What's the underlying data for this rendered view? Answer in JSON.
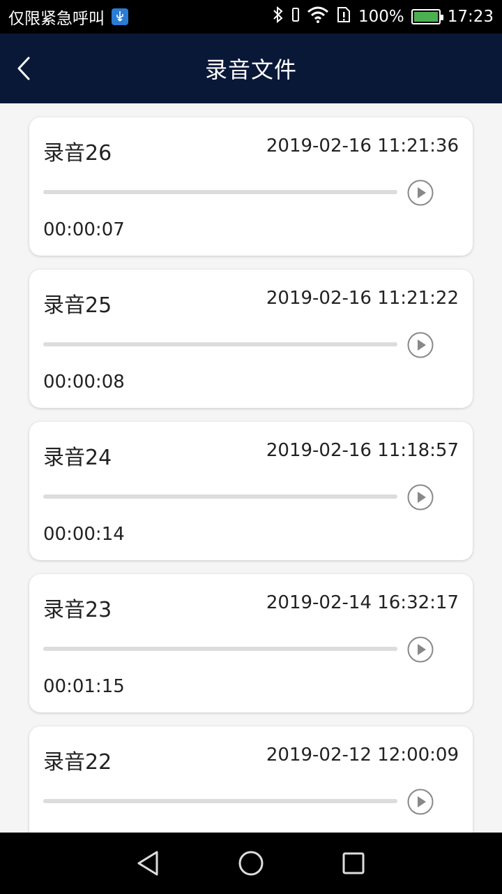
{
  "status_bar": {
    "carrier_text": "仅限紧急呼叫",
    "battery": "100%",
    "time": "17:23"
  },
  "app_bar": {
    "title": "录音文件",
    "back_icon": "chevron-left-icon"
  },
  "recordings": [
    {
      "name": "录音26",
      "date": "2019-02-16 11:21:36",
      "duration": "00:00:07",
      "progress": 0
    },
    {
      "name": "录音25",
      "date": "2019-02-16 11:21:22",
      "duration": "00:00:08",
      "progress": 0
    },
    {
      "name": "录音24",
      "date": "2019-02-16 11:18:57",
      "duration": "00:00:14",
      "progress": 0
    },
    {
      "name": "录音23",
      "date": "2019-02-14 16:32:17",
      "duration": "00:01:15",
      "progress": 0
    },
    {
      "name": "录音22",
      "date": "2019-02-12 12:00:09",
      "duration": "",
      "progress": 0
    }
  ],
  "colors": {
    "app_bar": "#0a1838",
    "status_bar": "#000000",
    "background": "#f5f5f5",
    "track": "#dcdcdc",
    "battery": "#4caf50"
  },
  "nav_bar": {
    "icons": [
      "back-triangle-icon",
      "home-circle-icon",
      "recents-square-icon"
    ]
  }
}
